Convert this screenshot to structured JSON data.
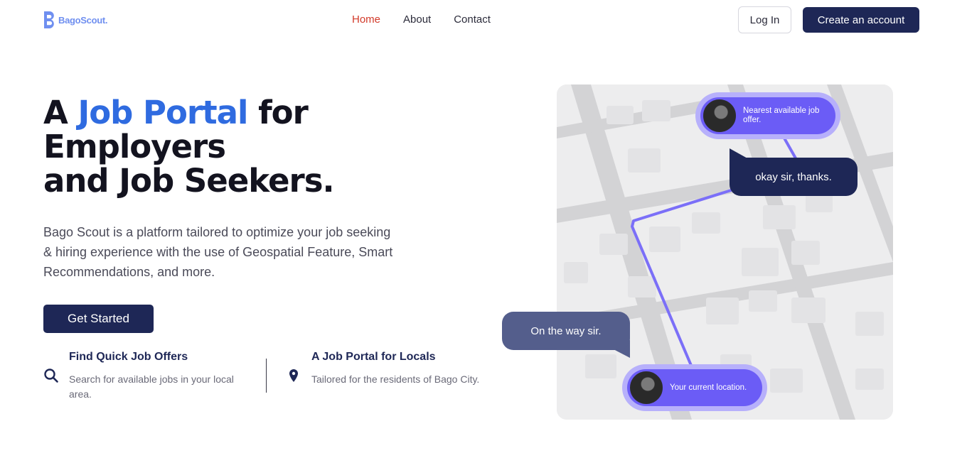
{
  "brand": {
    "name": "BagoScout."
  },
  "nav": {
    "links": [
      {
        "label": "Home",
        "active": true
      },
      {
        "label": "About",
        "active": false
      },
      {
        "label": "Contact",
        "active": false
      }
    ],
    "login_label": "Log In",
    "create_label": "Create an account"
  },
  "hero": {
    "title_prefix": "A ",
    "title_accent": "Job Portal",
    "title_suffix": " for",
    "title_line2": "Employers",
    "title_line3": "and Job Seekers.",
    "description": "Bago Scout is a platform tailored to optimize your job seeking & hiring experience with the use of Geospatial Feature, Smart Recommendations, and more.",
    "cta_label": "Get Started"
  },
  "features": [
    {
      "title": "Find Quick Job Offers",
      "description": "Search for available jobs in your local area.",
      "icon": "search-icon"
    },
    {
      "title": "A Job Portal for Locals",
      "description": "Tailored for the residents of Bago City.",
      "icon": "location-pin-icon"
    }
  ],
  "map": {
    "top_pin": "Nearest available job offer.",
    "bottom_pin": "Your current location.",
    "bubble_reply": "okay sir, thanks.",
    "bubble_status": "On the way sir."
  },
  "colors": {
    "accent": "#2f6be0",
    "navy": "#1e2756",
    "nav_active": "#d23a2a",
    "route": "#7b6ff8"
  }
}
